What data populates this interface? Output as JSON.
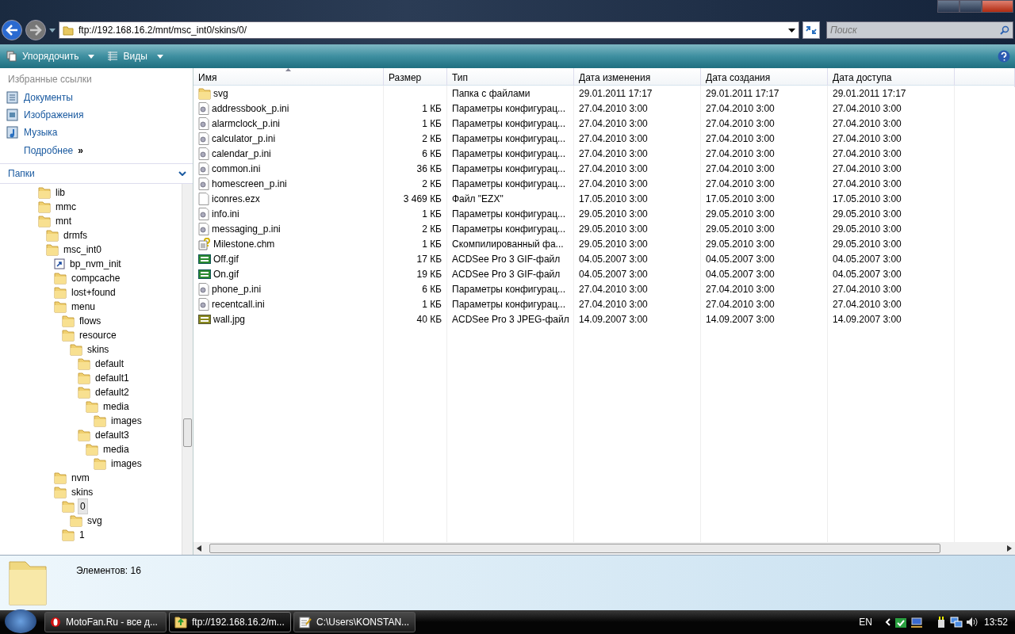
{
  "address": {
    "path": "ftp://192.168.16.2/mnt/msc_int0/skins/0/"
  },
  "search": {
    "placeholder": "Поиск"
  },
  "toolbar": {
    "buttons": [
      "Упорядочить",
      "Виды"
    ]
  },
  "nav_pane": {
    "favorites_title": "Избранные ссылки",
    "favorites": [
      {
        "label": "Документы",
        "kind": "documents"
      },
      {
        "label": "Изображения",
        "kind": "pictures"
      },
      {
        "label": "Музыка",
        "kind": "music"
      }
    ],
    "more": {
      "label": "Подробнее",
      "chevron": "»"
    },
    "folders_title": "Папки",
    "tree": [
      {
        "label": "lib",
        "selected": false
      },
      {
        "label": "mmc",
        "selected": false
      },
      {
        "label": "mnt",
        "selected": false,
        "children": [
          {
            "label": "drmfs",
            "selected": false
          },
          {
            "label": "msc_int0",
            "selected": false,
            "children": [
              {
                "label": "bp_nvm_init",
                "kind": "shortcut",
                "selected": false
              },
              {
                "label": "compcache",
                "selected": false
              },
              {
                "label": "lost+found",
                "selected": false
              },
              {
                "label": "menu",
                "selected": false,
                "children": [
                  {
                    "label": "flows",
                    "selected": false
                  },
                  {
                    "label": "resource",
                    "selected": false,
                    "children": [
                      {
                        "label": "skins",
                        "selected": false,
                        "children": [
                          {
                            "label": "default",
                            "selected": false
                          },
                          {
                            "label": "default1",
                            "selected": false
                          },
                          {
                            "label": "default2",
                            "selected": false,
                            "children": [
                              {
                                "label": "media",
                                "selected": false,
                                "children": [
                                  {
                                    "label": "images",
                                    "selected": false
                                  }
                                ]
                              }
                            ]
                          },
                          {
                            "label": "default3",
                            "selected": false,
                            "children": [
                              {
                                "label": "media",
                                "selected": false,
                                "children": [
                                  {
                                    "label": "images",
                                    "selected": false
                                  }
                                ]
                              }
                            ]
                          }
                        ]
                      }
                    ]
                  }
                ]
              },
              {
                "label": "nvm",
                "selected": false
              },
              {
                "label": "skins",
                "selected": false,
                "children": [
                  {
                    "label": "0",
                    "selected": true,
                    "children": [
                      {
                        "label": "svg",
                        "selected": false
                      }
                    ]
                  },
                  {
                    "label": "1",
                    "selected": false
                  }
                ]
              }
            ]
          }
        ]
      }
    ]
  },
  "table": {
    "columns": [
      "Имя",
      "Размер",
      "Тип",
      "Дата изменения",
      "Дата создания",
      "Дата доступа"
    ],
    "rows": [
      {
        "kind": "folder",
        "name": "svg",
        "size": "",
        "type": "Папка с файлами",
        "modified": "29.01.2011 17:17",
        "created": "29.01.2011 17:17",
        "accessed": "29.01.2011 17:17"
      },
      {
        "kind": "ini",
        "name": "addressbook_p.ini",
        "size": "1 КБ",
        "type": "Параметры конфигурац...",
        "modified": "27.04.2010 3:00",
        "created": "27.04.2010 3:00",
        "accessed": "27.04.2010 3:00"
      },
      {
        "kind": "ini",
        "name": "alarmclock_p.ini",
        "size": "1 КБ",
        "type": "Параметры конфигурац...",
        "modified": "27.04.2010 3:00",
        "created": "27.04.2010 3:00",
        "accessed": "27.04.2010 3:00"
      },
      {
        "kind": "ini",
        "name": "calculator_p.ini",
        "size": "2 КБ",
        "type": "Параметры конфигурац...",
        "modified": "27.04.2010 3:00",
        "created": "27.04.2010 3:00",
        "accessed": "27.04.2010 3:00"
      },
      {
        "kind": "ini",
        "name": "calendar_p.ini",
        "size": "6 КБ",
        "type": "Параметры конфигурац...",
        "modified": "27.04.2010 3:00",
        "created": "27.04.2010 3:00",
        "accessed": "27.04.2010 3:00"
      },
      {
        "kind": "ini",
        "name": "common.ini",
        "size": "36 КБ",
        "type": "Параметры конфигурац...",
        "modified": "27.04.2010 3:00",
        "created": "27.04.2010 3:00",
        "accessed": "27.04.2010 3:00"
      },
      {
        "kind": "ini",
        "name": "homescreen_p.ini",
        "size": "2 КБ",
        "type": "Параметры конфигурац...",
        "modified": "27.04.2010 3:00",
        "created": "27.04.2010 3:00",
        "accessed": "27.04.2010 3:00"
      },
      {
        "kind": "file",
        "name": "iconres.ezx",
        "size": "3 469 КБ",
        "type": "Файл \"EZX\"",
        "modified": "17.05.2010 3:00",
        "created": "17.05.2010 3:00",
        "accessed": "17.05.2010 3:00"
      },
      {
        "kind": "ini",
        "name": "info.ini",
        "size": "1 КБ",
        "type": "Параметры конфигурац...",
        "modified": "29.05.2010 3:00",
        "created": "29.05.2010 3:00",
        "accessed": "29.05.2010 3:00"
      },
      {
        "kind": "ini",
        "name": "messaging_p.ini",
        "size": "2 КБ",
        "type": "Параметры конфигурац...",
        "modified": "29.05.2010 3:00",
        "created": "29.05.2010 3:00",
        "accessed": "29.05.2010 3:00"
      },
      {
        "kind": "help",
        "name": "Milestone.chm",
        "size": "1 КБ",
        "type": "Скомпилированный фа...",
        "modified": "29.05.2010 3:00",
        "created": "29.05.2010 3:00",
        "accessed": "29.05.2010 3:00"
      },
      {
        "kind": "gif",
        "name": "Off.gif",
        "size": "17 КБ",
        "type": "ACDSee Pro 3 GIF-файл",
        "modified": "04.05.2007 3:00",
        "created": "04.05.2007 3:00",
        "accessed": "04.05.2007 3:00"
      },
      {
        "kind": "gif",
        "name": "On.gif",
        "size": "19 КБ",
        "type": "ACDSee Pro 3 GIF-файл",
        "modified": "04.05.2007 3:00",
        "created": "04.05.2007 3:00",
        "accessed": "04.05.2007 3:00"
      },
      {
        "kind": "ini",
        "name": "phone_p.ini",
        "size": "6 КБ",
        "type": "Параметры конфигурац...",
        "modified": "27.04.2010 3:00",
        "created": "27.04.2010 3:00",
        "accessed": "27.04.2010 3:00"
      },
      {
        "kind": "ini",
        "name": "recentcall.ini",
        "size": "1 КБ",
        "type": "Параметры конфигурац...",
        "modified": "27.04.2010 3:00",
        "created": "27.04.2010 3:00",
        "accessed": "27.04.2010 3:00"
      },
      {
        "kind": "jpg",
        "name": "wall.jpg",
        "size": "40 КБ",
        "type": "ACDSee Pro 3 JPEG-файл",
        "modified": "14.09.2007 3:00",
        "created": "14.09.2007 3:00",
        "accessed": "14.09.2007 3:00"
      }
    ]
  },
  "status_bar": {
    "text": "Элементов: 16"
  },
  "taskbar": {
    "tasks": [
      {
        "label": "MotoFan.Ru - все д...",
        "kind": "browser",
        "selected": false
      },
      {
        "label": "ftp://192.168.16.2/m...",
        "kind": "folder",
        "selected": true
      },
      {
        "label": "C:\\Users\\KONSTAN...",
        "kind": "notepad",
        "selected": false
      }
    ],
    "language": "EN",
    "clock": "13:52"
  }
}
